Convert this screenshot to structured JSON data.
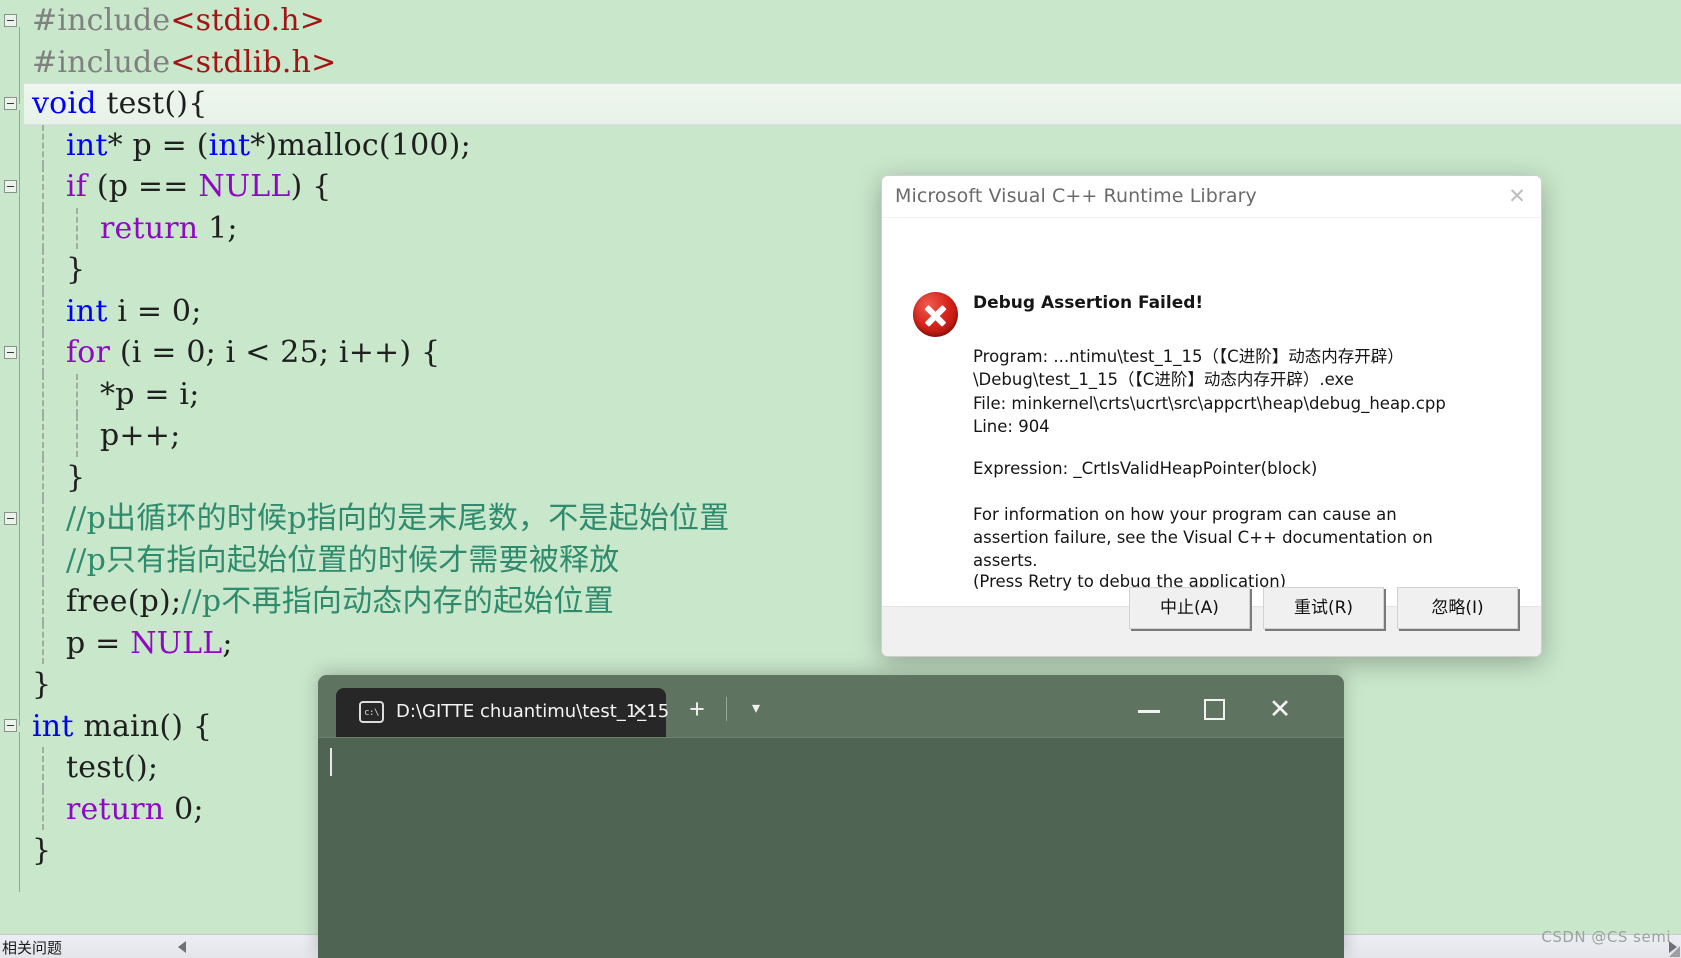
{
  "editor": {
    "lines": [
      {
        "indent": 0,
        "fold": true,
        "segs": [
          {
            "t": "#include",
            "c": "pp"
          },
          {
            "t": "<stdio.h>",
            "c": "str"
          }
        ]
      },
      {
        "indent": 0,
        "fold": false,
        "segs": [
          {
            "t": "#include",
            "c": "pp"
          },
          {
            "t": "<stdlib.h>",
            "c": "str"
          }
        ]
      },
      {
        "indent": 0,
        "fold": true,
        "highlight": true,
        "segs": [
          {
            "t": "void",
            "c": "kw"
          },
          {
            "t": " test(){",
            "c": "pln"
          }
        ]
      },
      {
        "indent": 1,
        "fold": false,
        "segs": [
          {
            "t": "int",
            "c": "kw"
          },
          {
            "t": "* p = (",
            "c": "pln"
          },
          {
            "t": "int",
            "c": "kw"
          },
          {
            "t": "*)malloc(100);",
            "c": "pln"
          }
        ]
      },
      {
        "indent": 1,
        "fold": true,
        "segs": [
          {
            "t": "if",
            "c": "kw2"
          },
          {
            "t": " (p == ",
            "c": "pln"
          },
          {
            "t": "NULL",
            "c": "macro"
          },
          {
            "t": ") {",
            "c": "pln"
          }
        ]
      },
      {
        "indent": 2,
        "fold": false,
        "segs": [
          {
            "t": "return",
            "c": "kw2"
          },
          {
            "t": " 1;",
            "c": "pln"
          }
        ]
      },
      {
        "indent": 1,
        "fold": false,
        "segs": [
          {
            "t": "}",
            "c": "pln"
          }
        ]
      },
      {
        "indent": 1,
        "fold": false,
        "segs": [
          {
            "t": "int",
            "c": "kw"
          },
          {
            "t": " i = 0;",
            "c": "pln"
          }
        ]
      },
      {
        "indent": 1,
        "fold": true,
        "segs": [
          {
            "t": "for",
            "c": "kw2"
          },
          {
            "t": " (i = 0; i < 25; i++) {",
            "c": "pln"
          }
        ]
      },
      {
        "indent": 2,
        "fold": false,
        "segs": [
          {
            "t": "*p = i;",
            "c": "pln"
          }
        ]
      },
      {
        "indent": 2,
        "fold": false,
        "segs": [
          {
            "t": "p++;",
            "c": "pln"
          }
        ]
      },
      {
        "indent": 1,
        "fold": false,
        "segs": [
          {
            "t": "}",
            "c": "pln"
          }
        ]
      },
      {
        "indent": 1,
        "fold": true,
        "segs": [
          {
            "t": "//p出循环的时候p指向的是末尾数，不是起始位置",
            "c": "cmt"
          }
        ]
      },
      {
        "indent": 1,
        "fold": false,
        "segs": [
          {
            "t": "//p只有指向起始位置的时候才需要被释放",
            "c": "cmt"
          }
        ]
      },
      {
        "indent": 1,
        "fold": false,
        "segs": [
          {
            "t": "free(p);",
            "c": "pln"
          },
          {
            "t": "//p不再指向动态内存的起始位置",
            "c": "cmt"
          }
        ]
      },
      {
        "indent": 1,
        "fold": false,
        "segs": [
          {
            "t": "p = ",
            "c": "pln"
          },
          {
            "t": "NULL",
            "c": "macro"
          },
          {
            "t": ";",
            "c": "pln"
          }
        ]
      },
      {
        "indent": 0,
        "fold": false,
        "segs": [
          {
            "t": "}",
            "c": "pln"
          }
        ]
      },
      {
        "indent": 0,
        "fold": true,
        "segs": [
          {
            "t": "int",
            "c": "kw"
          },
          {
            "t": " main() {",
            "c": "pln"
          }
        ]
      },
      {
        "indent": 1,
        "fold": false,
        "segs": [
          {
            "t": "test();",
            "c": "pln"
          }
        ]
      },
      {
        "indent": 1,
        "fold": false,
        "segs": [
          {
            "t": "return",
            "c": "kw2"
          },
          {
            "t": " 0;",
            "c": "pln"
          }
        ]
      },
      {
        "indent": 0,
        "fold": false,
        "segs": [
          {
            "t": "}",
            "c": "pln"
          }
        ]
      }
    ]
  },
  "statusbar": {
    "text": "相关问题",
    "scroll_left_icon": "triangle-left-icon",
    "scroll_right_icon": "triangle-right-icon"
  },
  "dialog": {
    "title": "Microsoft Visual C++ Runtime Library",
    "close_icon": "close-icon",
    "error_icon": "error-circle-icon",
    "heading": "Debug Assertion Failed!",
    "program": "Program: ...ntimu\\test_1_15（【C进阶】动态内存开辟）\\Debug\\test_1_15（【C进阶】动态内存开辟）.exe",
    "file": "File: minkernel\\crts\\ucrt\\src\\appcrt\\heap\\debug_heap.cpp",
    "line": "Line: 904",
    "expression": "Expression: _CrtIsValidHeapPointer(block)",
    "info": "For information on how your program can cause an assertion failure, see the Visual C++ documentation on asserts.",
    "press_hint": "(Press Retry to debug the application)",
    "buttons": [
      {
        "label": "中止(A)",
        "name": "abort-button"
      },
      {
        "label": "重试(R)",
        "name": "retry-button"
      },
      {
        "label": "忽略(I)",
        "name": "ignore-button"
      }
    ]
  },
  "terminal": {
    "tab": {
      "icon": "cmd-icon",
      "icon_text": "c:\\",
      "title": "D:\\GITTE chuantimu\\test_1_15",
      "close_icon": "close-icon"
    },
    "new_tab_icon": "plus-icon",
    "dropdown_icon": "chevron-down-icon",
    "minimize_icon": "minimize-icon",
    "maximize_icon": "maximize-icon",
    "close_icon": "close-icon",
    "content": ""
  },
  "watermark": {
    "text": "CSDN @CS semi"
  },
  "colors": {
    "editor_bg": "#c9e7cb",
    "keyword": "#0000ff",
    "keyword2": "#8f08c4",
    "string": "#a31515",
    "comment": "#2e8b6e",
    "preprocessor": "#808080",
    "terminal_bg": "#4f6452",
    "terminal_chrome": "#5e7360",
    "error_red": "#d6231a"
  }
}
